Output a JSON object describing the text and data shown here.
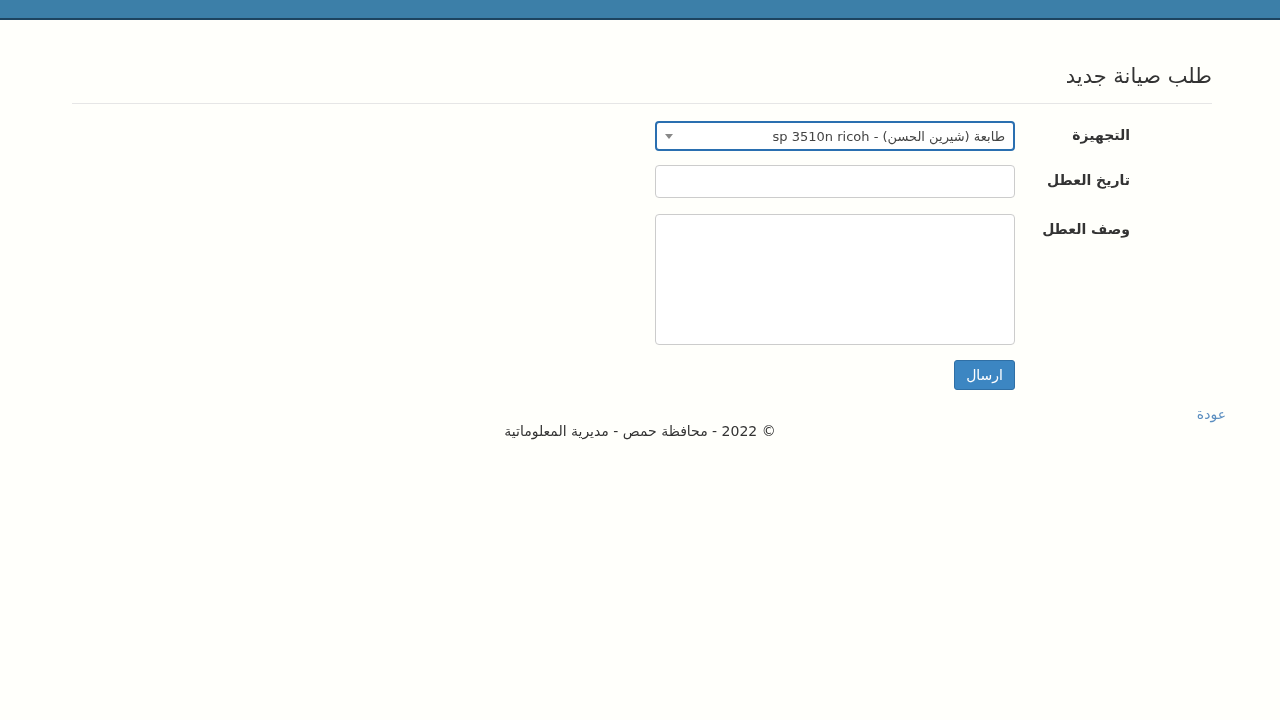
{
  "page_title": "طلب صيانة جديد",
  "fields": [
    {
      "kind": "select",
      "label": "التجهيزة",
      "value": "طابعة (شيرين الحسن) - sp 3510n ricoh",
      "focused": true
    },
    {
      "kind": "input",
      "label": "تاريخ العطل",
      "focused": false
    },
    {
      "kind": "textarea",
      "label": "وصف العطل",
      "focused": false
    }
  ],
  "submit_button": "ارسال",
  "back_link": "عودة",
  "footer": "© 2022 - محافظة حمص - مديرية المعلوماتية"
}
